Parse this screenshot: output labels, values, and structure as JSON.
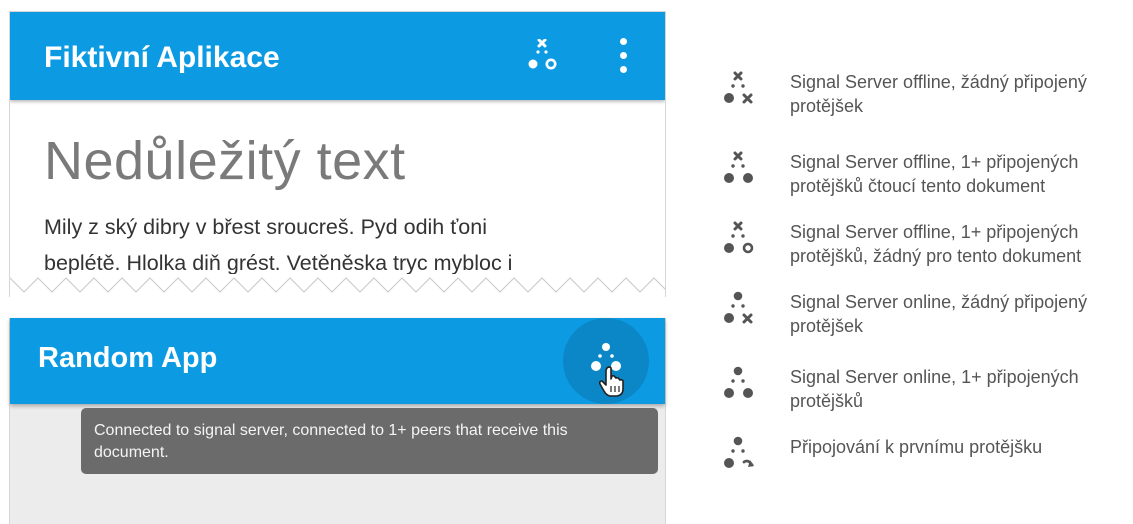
{
  "app_top": {
    "title": "Fiktivní Aplikace",
    "heading": "Nedůležitý text",
    "body_line1": "Mily z ský dibry v břest sroucreš. Pyd odih ťoni",
    "body_line2": "beplétě. Hlolka diň grést. Vetěněska tryc mybloc i",
    "status_icon": "server-offline-peers-none-reading-icon",
    "menu_icon": "more-vert-icon"
  },
  "app_bottom": {
    "title": "Random App",
    "status_icon": "server-online-peers-connected-icon",
    "tooltip": "Connected to signal server, connected to 1+ peers that receive this document."
  },
  "legend": [
    {
      "icon": "server-offline-no-peer-icon",
      "text": "Signal Server offline, žádný připojený protějšek"
    },
    {
      "icon": "server-offline-peers-reading-icon",
      "text": "Signal Server offline, 1+ připojených protějšků čtoucí tento dokument"
    },
    {
      "icon": "server-offline-peers-not-reading-icon",
      "text": "Signal Server offline, 1+ připojených protějšků, žádný pro tento dokument"
    },
    {
      "icon": "server-online-no-peer-icon",
      "text": "Signal Server online, žádný připojený protějšek"
    },
    {
      "icon": "server-online-peers-icon",
      "text": "Signal Server online, 1+ připojených protějšků"
    },
    {
      "icon": "connecting-to-first-peer-icon",
      "text": "Připojování k prvnímu protějšku"
    }
  ],
  "colors": {
    "appbar": "#0c9be3",
    "icon_gray": "#555555",
    "tooltip_bg": "#6b6b6b"
  }
}
